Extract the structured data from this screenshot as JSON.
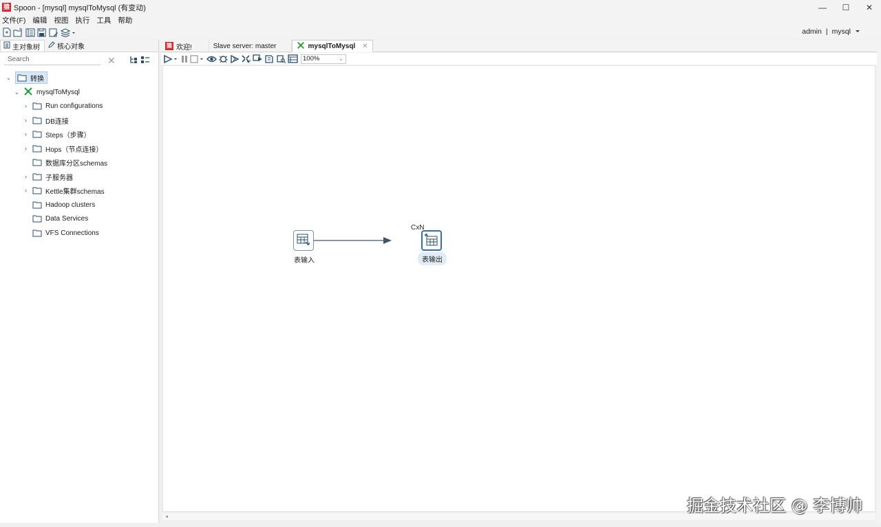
{
  "window": {
    "title": "Spoon - [mysql] mysqlToMysql (有变动)",
    "app_icon_text": "猿",
    "controls": {
      "minimize": "—",
      "maximize": "☐",
      "close": "✕"
    }
  },
  "menu": [
    "文件(F)",
    "编辑",
    "视图",
    "执行",
    "工具",
    "帮助"
  ],
  "toolbar": {
    "buttons": [
      "new-file-icon",
      "open-icon",
      "explore-icon",
      "save-icon",
      "save-as-icon",
      "layers-icon"
    ],
    "user": "admin",
    "separator": "|",
    "repository": "mysql"
  },
  "left_panel": {
    "tabs": [
      {
        "label": "主对象树",
        "icon": "tree-icon"
      },
      {
        "label": "核心对象",
        "icon": "pencil-icon"
      }
    ],
    "search_placeholder": "Search",
    "tree": [
      {
        "label": "转换",
        "level": 0,
        "expanded": true,
        "selected": true
      },
      {
        "label": "mysqlToMysql",
        "level": 1,
        "expanded": true
      },
      {
        "label": "Run configurations",
        "level": 2,
        "has_children": true
      },
      {
        "label": "DB连接",
        "level": 2,
        "has_children": true
      },
      {
        "label": "Steps（步骤）",
        "level": 2,
        "has_children": true
      },
      {
        "label": "Hops（节点连接）",
        "level": 2,
        "has_children": true
      },
      {
        "label": "数据库分区schemas",
        "level": 2,
        "has_children": false
      },
      {
        "label": "子服务器",
        "level": 2,
        "has_children": true
      },
      {
        "label": "Kettle集群schemas",
        "level": 2,
        "has_children": true
      },
      {
        "label": "Hadoop clusters",
        "level": 2,
        "has_children": false
      },
      {
        "label": "Data Services",
        "level": 2,
        "has_children": false
      },
      {
        "label": "VFS Connections",
        "level": 2,
        "has_children": false
      }
    ]
  },
  "editor": {
    "tabs": [
      {
        "label": "欢迎!",
        "active": false
      },
      {
        "label": "Slave server: master",
        "active": false
      },
      {
        "label": "mysqlToMysql",
        "active": true,
        "close": "✕"
      }
    ],
    "zoom": "100%",
    "steps": [
      {
        "label": "表输入",
        "selected": false
      },
      {
        "label": "表输出",
        "selected": true
      }
    ],
    "hop_badge": "CxN"
  },
  "watermark": "掘金技术社区 @ 李博帅",
  "colors": {
    "accent": "#2f70b2",
    "hop": "#3b5773",
    "selection": "#d8e8f8"
  }
}
